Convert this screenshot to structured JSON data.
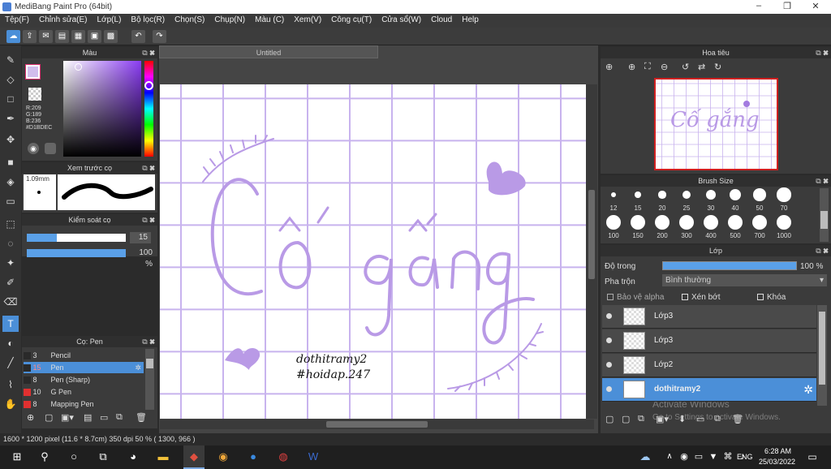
{
  "window": {
    "title": "MediBang Paint Pro (64bit)",
    "controls": [
      "–",
      "❐",
      "✕"
    ]
  },
  "menu": [
    "Tệp(F)",
    "Chỉnh sửa(E)",
    "Lớp(L)",
    "Bộ lọc(R)",
    "Chọn(S)",
    "Chụp(N)",
    "Màu (C)",
    "Xem(V)",
    "Công cụ(T)",
    "Cửa sổ(W)",
    "Cloud",
    "Help"
  ],
  "color_panel": {
    "title": "Màu",
    "r": "R:209",
    "g": "G:189",
    "b": "B:236",
    "hex": "#D1BDEC",
    "color": "#D1BDEC"
  },
  "brush_preview": {
    "title": "Xem trước cọ",
    "size": "1.09mm"
  },
  "brush_control": {
    "title": "Kiểm soát cọ",
    "size_value": "15",
    "opacity_value": "100 %",
    "size_fraction": 0.3,
    "opacity_fraction": 1.0
  },
  "brush_list": {
    "title": "Cọ: Pen",
    "items": [
      {
        "num": "3",
        "name": "Pencil",
        "color": "#2a2a2a"
      },
      {
        "num": "15",
        "name": "Pen",
        "color": "#2a2a2a",
        "selected": true
      },
      {
        "num": "8",
        "name": "Pen (Sharp)",
        "color": "#2a2a2a"
      },
      {
        "num": "10",
        "name": "G Pen",
        "color": "#e03030"
      },
      {
        "num": "8",
        "name": "Mapping Pen",
        "color": "#e03030"
      }
    ]
  },
  "canvas": {
    "tab": "Untitled",
    "text_main": "Cố gắng",
    "text_sig1": "dothitramy2",
    "text_sig2": "#hoidap.247",
    "ink_color": "#b99ae6",
    "grid_color": "#c8b3ee"
  },
  "navigator": {
    "title": "Hoa tiêu"
  },
  "brush_size": {
    "title": "Brush Size",
    "sizes": [
      "12",
      "15",
      "20",
      "25",
      "30",
      "40",
      "50",
      "70",
      "100",
      "150",
      "200",
      "300",
      "400",
      "500",
      "700",
      "1000"
    ]
  },
  "layers": {
    "title": "Lớp",
    "opacity_label": "Độ trong",
    "opacity_value": "100 %",
    "blend_label": "Pha trộn",
    "blend_value": "Bình thường",
    "alpha_label": "Bảo vệ alpha",
    "clip_label": "Xén bớt",
    "lock_label": "Khóa",
    "items": [
      {
        "name": "Lớp3"
      },
      {
        "name": "Lớp3"
      },
      {
        "name": "Lớp2"
      },
      {
        "name": "dothitramy2",
        "selected": true
      }
    ],
    "watermark1": "Activate Windows",
    "watermark2": "Go to Settings to activate Windows."
  },
  "status": "1600 * 1200 pixel   (11.6 * 8.7cm)   350 dpi   50 %   ( 1300, 966 )",
  "taskbar": {
    "lang": "ENG",
    "time": "6:28 AM",
    "date": "25/03/2022"
  }
}
